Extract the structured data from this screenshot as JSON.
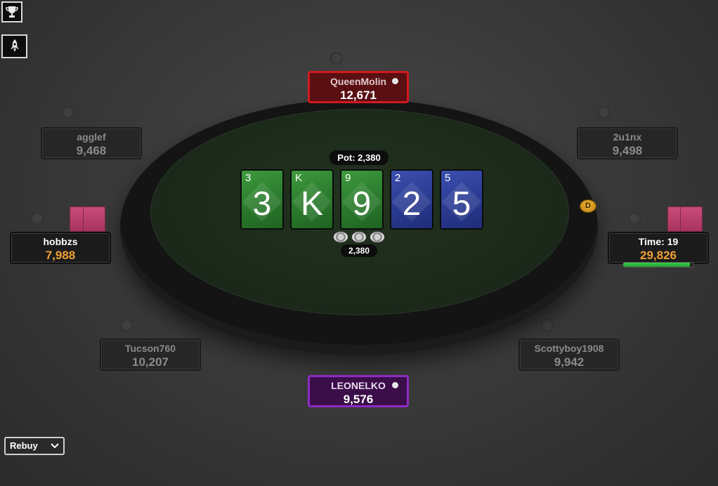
{
  "toolbar": {
    "trophy_icon": "trophy-icon",
    "rocket_icon": "rocket-icon"
  },
  "table": {
    "pot_label": "Pot: 2,380",
    "bet_amount": "2,380",
    "board": [
      {
        "rank": "3",
        "color": "green"
      },
      {
        "rank": "K",
        "color": "green"
      },
      {
        "rank": "9",
        "color": "green"
      },
      {
        "rank": "2",
        "color": "blue"
      },
      {
        "rank": "5",
        "color": "blue"
      }
    ],
    "dealer_button": "D"
  },
  "seats": {
    "top": {
      "name": "QueenMolin",
      "stack": "12,671"
    },
    "top_left": {
      "name": "agglef",
      "stack": "9,468"
    },
    "top_right": {
      "name": "2u1nx",
      "stack": "9,498"
    },
    "left": {
      "name": "hobbzs",
      "stack": "7,988"
    },
    "right": {
      "name": "Time: 19",
      "stack": "29,826",
      "timer_fraction": 0.95
    },
    "bottom_left": {
      "name": "Tucson760",
      "stack": "10,207"
    },
    "bottom_right": {
      "name": "Scottyboy1908",
      "stack": "9,942"
    },
    "bottom": {
      "name": "LEONELKO",
      "stack": "9,576"
    }
  },
  "controls": {
    "rebuy_label": "Rebuy"
  },
  "colors": {
    "felt": "#1c2a1a",
    "stack_active": "#f0a036",
    "seat_red_border": "#d21a1f",
    "seat_purple_border": "#8d2cc3",
    "card_green": "#2a7a2c",
    "card_blue": "#2a3b91",
    "card_back": "#c94a78"
  }
}
